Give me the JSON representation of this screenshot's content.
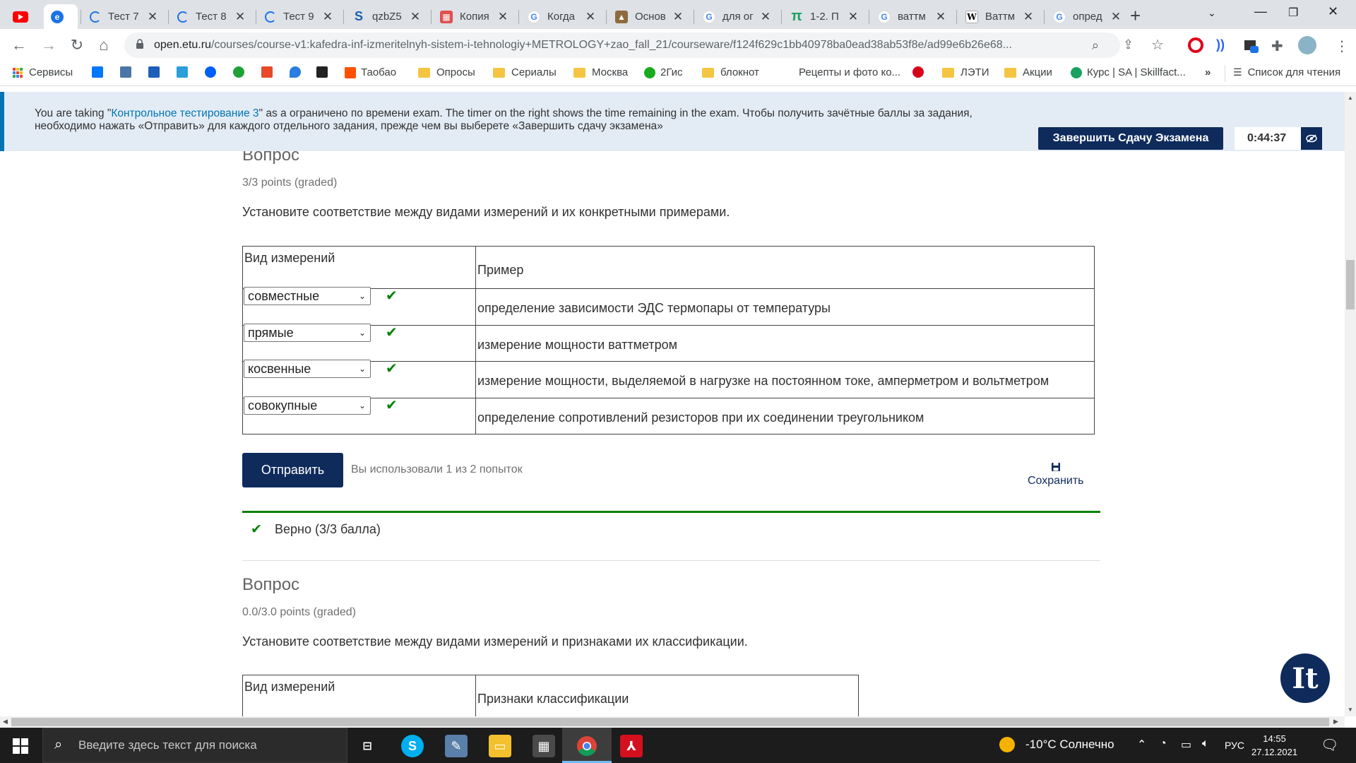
{
  "browser": {
    "tabs": [
      {
        "title": "",
        "icon": "youtube-icon",
        "color": "#ff0000"
      },
      {
        "title": "",
        "icon": "edge-icon",
        "color": "#1a73e8",
        "active": true
      },
      {
        "title": "Тест 7",
        "icon": "loading-icon",
        "color": "#1a73e8"
      },
      {
        "title": "Тест 8",
        "icon": "loading-icon",
        "color": "#1a73e8"
      },
      {
        "title": "Тест 9",
        "icon": "loading-icon",
        "color": "#1a73e8"
      },
      {
        "title": "qzbZ5",
        "icon": "s-icon",
        "color": "#1a5fb4"
      },
      {
        "title": "Копия",
        "icon": "calendar-icon",
        "color": "#e04f4f"
      },
      {
        "title": "Когда",
        "icon": "google-icon",
        "color": "#4285f4"
      },
      {
        "title": "Основ",
        "icon": "site-icon",
        "color": "#8e6b3e"
      },
      {
        "title": "для ог",
        "icon": "google-icon",
        "color": "#4285f4"
      },
      {
        "title": "1-2. П",
        "icon": "pi-icon",
        "color": "#1aa260"
      },
      {
        "title": "ваттм",
        "icon": "google-icon",
        "color": "#4285f4"
      },
      {
        "title": "Ваттм",
        "icon": "wikipedia-icon",
        "color": "#000000"
      },
      {
        "title": "опред",
        "icon": "google-icon",
        "color": "#4285f4"
      }
    ],
    "url_host": "open.etu.ru",
    "url_path": "/courses/course-v1:kafedra-inf-izmeritelnyh-sistem-i-tehnologiy+METROLOGY+zao_fall_21/courseware/f124f629c1bb40978ba0ead38ab53f8e/ad99e6b26e68...",
    "bookmarks": [
      {
        "label": "Сервисы",
        "type": "apps"
      },
      {
        "label": "",
        "type": "icon",
        "color": "#0077ff"
      },
      {
        "label": "",
        "type": "icon",
        "color": "#4a76a8"
      },
      {
        "label": "",
        "type": "icon",
        "color": "#1e5eb8"
      },
      {
        "label": "",
        "type": "icon",
        "color": "#2b9fd9"
      },
      {
        "label": "",
        "type": "icon",
        "color": "#005ff9"
      },
      {
        "label": "",
        "type": "icon",
        "color": "#21a038"
      },
      {
        "label": "",
        "type": "icon",
        "color": "#e8492b"
      },
      {
        "label": "",
        "type": "icon",
        "color": "#2a7de1"
      },
      {
        "label": "",
        "type": "icon",
        "color": "#222222"
      },
      {
        "label": "Таобао",
        "type": "icon",
        "color": "#ff5000"
      },
      {
        "label": "Опросы",
        "type": "folder"
      },
      {
        "label": "Сериалы",
        "type": "folder"
      },
      {
        "label": "Москва",
        "type": "folder"
      },
      {
        "label": "2Гис",
        "type": "icon",
        "color": "#19aa1e"
      },
      {
        "label": "блокнот",
        "type": "folder"
      },
      {
        "label": "Рецепты и фото ко...",
        "type": "icon",
        "color": "#ffffff"
      },
      {
        "label": "",
        "type": "icon",
        "color": "#d6001c"
      },
      {
        "label": "ЛЭТИ",
        "type": "folder"
      },
      {
        "label": "Акции",
        "type": "folder"
      },
      {
        "label": "Курс | SA | Skillfact...",
        "type": "icon",
        "color": "#1aa260"
      }
    ],
    "bookmarks_more": "»",
    "reading_list": "Список для чтения"
  },
  "exam_banner": {
    "prefix": "You are taking \"",
    "exam_name": "Контрольное тестирование 3",
    "line1_rest": "\" as a ограничено по времени exam. The timer on the right shows the time remaining in the exam. Чтобы получить зачётные баллы за задания,",
    "line2": "необходимо нажать «Отправить» для каждого отдельного задания, прежде чем вы выберете «Завершить сдачу экзамена»",
    "finish_label": "Завершить Сдачу Экзамена",
    "timer": "0:44:37"
  },
  "problem1": {
    "title": "Вопрос",
    "points": "3/3 points (graded)",
    "text": "Установите соответствие между видами измерений и их конкретными примерами.",
    "header_col1": "Вид измерений",
    "header_col2": "Пример",
    "rows": [
      {
        "selected": "совместные",
        "example": "определение зависимости ЭДС термопары от температуры"
      },
      {
        "selected": "прямые",
        "example": "измерение мощности ваттметром"
      },
      {
        "selected": "косвенные",
        "example": "измерение мощности, выделяемой в нагрузке на постоянном токе, амперметром и вольтметром"
      },
      {
        "selected": "совокупные",
        "example": "определение сопротивлений резисторов при их соединении треугольником"
      }
    ],
    "submit_label": "Отправить",
    "attempts_text": "Вы использовали 1 из 2 попыток",
    "save_label": "Сохранить",
    "result_text": "Верно (3/3 балла)",
    "status_color": "#008100"
  },
  "problem2": {
    "title": "Вопрос",
    "points": "0.0/3.0 points (graded)",
    "text": "Установите соответствие между видами измерений и признаками их классификации.",
    "header_col1": "Вид измерений",
    "header_col2": "Признаки классификации"
  },
  "widget": {
    "label": "It"
  },
  "taskbar": {
    "search_placeholder": "Введите здесь текст для поиска",
    "weather": "-10°C  Солнечно",
    "language": "РУС",
    "time": "14:55",
    "date": "27.12.2021"
  }
}
